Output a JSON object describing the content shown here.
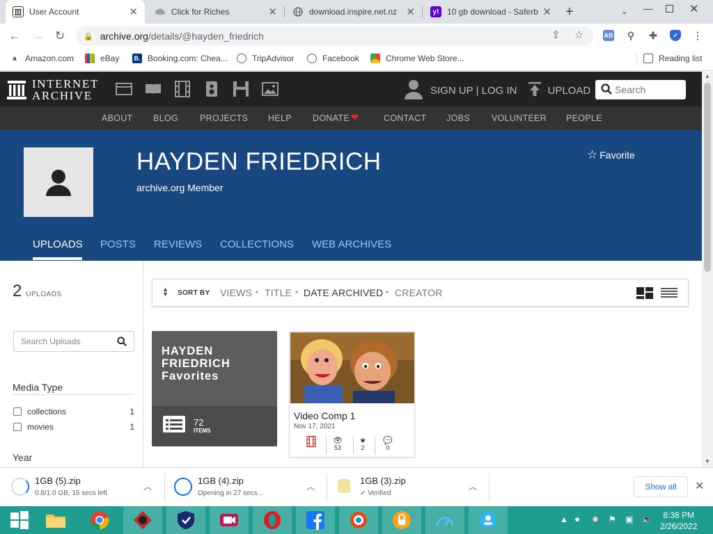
{
  "browser": {
    "tabs": [
      {
        "title": "User Account",
        "icon": "archive-icon",
        "active": true
      },
      {
        "title": "Click for Riches",
        "icon": "cloud-icon"
      },
      {
        "title": "download.inspire.net.nz",
        "icon": "globe-icon"
      },
      {
        "title": "10 gb download - Saferb",
        "icon": "yahoo-icon"
      }
    ],
    "new_tab_label": "+",
    "url_domain": "archive.org",
    "url_path": "/details/@hayden_friedrich",
    "bookmarks": [
      {
        "label": "Amazon.com",
        "icon": "amazon-icon"
      },
      {
        "label": "eBay",
        "icon": "ebay-icon"
      },
      {
        "label": "Booking.com: Chea...",
        "icon": "booking-icon"
      },
      {
        "label": "TripAdvisor",
        "icon": "globe-icon"
      },
      {
        "label": "Facebook",
        "icon": "globe-icon"
      },
      {
        "label": "Chrome Web Store...",
        "icon": "webstore-icon"
      }
    ],
    "reading_list_label": "Reading list"
  },
  "ia": {
    "logo_line1": "INTERNET",
    "logo_line2": "ARCHIVE",
    "signin_label": "SIGN UP | LOG IN",
    "upload_label": "UPLOAD",
    "search_placeholder": "Search",
    "subnav": [
      "ABOUT",
      "BLOG",
      "PROJECTS",
      "HELP",
      "DONATE",
      "CONTACT",
      "JOBS",
      "VOLUNTEER",
      "PEOPLE"
    ]
  },
  "profile": {
    "name": "HAYDEN FRIEDRICH",
    "role": "archive.org Member",
    "favorite_label": "Favorite",
    "tabs": [
      "UPLOADS",
      "POSTS",
      "REVIEWS",
      "COLLECTIONS",
      "WEB ARCHIVES"
    ],
    "active_tab": "UPLOADS"
  },
  "sidebar": {
    "upload_count": "2",
    "upload_label": "UPLOADS",
    "search_placeholder": "Search Uploads",
    "media_type_heading": "Media Type",
    "facets": [
      {
        "label": "collections",
        "count": "1"
      },
      {
        "label": "movies",
        "count": "1"
      }
    ],
    "year_heading": "Year"
  },
  "sort": {
    "label": "SORT BY",
    "options": [
      "VIEWS",
      "TITLE",
      "DATE ARCHIVED",
      "CREATOR"
    ],
    "active": "DATE ARCHIVED"
  },
  "tiles": {
    "favorites": {
      "title_line1": "HAYDEN",
      "title_line2": "FRIEDRICH",
      "title_line3": "Favorites",
      "count": "72",
      "count_label": "ITEMS"
    },
    "video": {
      "title": "Video Comp 1",
      "date": "Nov 17, 2021",
      "views": "53",
      "favorites": "2",
      "reviews": "0"
    }
  },
  "downloads": {
    "items": [
      {
        "name": "1GB (5).zip",
        "status": "0.8/1.0 GB, 16 secs left"
      },
      {
        "name": "1GB (4).zip",
        "status": "Opening in 27 secs..."
      },
      {
        "name": "1GB (3).zip",
        "status": "Verified"
      }
    ],
    "show_all_label": "Show all"
  },
  "taskbar": {
    "time": "8:38 PM",
    "date": "2/26/2022"
  },
  "colors": {
    "profile_bg": "#194880",
    "taskbar_bg": "#1f9e8f",
    "link_blue": "#8fc7ff",
    "donate_heart": "#e22"
  }
}
